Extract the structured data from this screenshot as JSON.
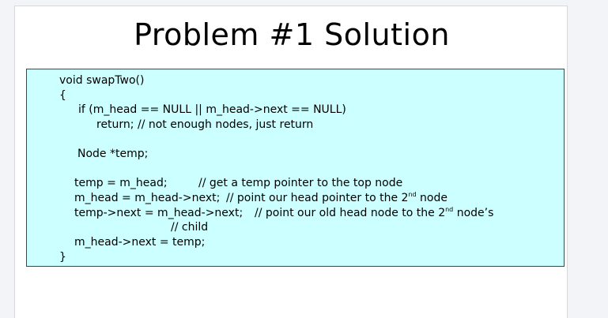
{
  "slide": {
    "title": "Problem #1 Solution"
  },
  "code": {
    "l1": "void swapTwo()",
    "l2": "{",
    "l3": "if (m_head == NULL || m_head->next == NULL)",
    "l4": "return; // not enough nodes, just return",
    "l5": "Node *temp;",
    "l6a": "temp = m_head;",
    "l6b": "// get a temp pointer to the top node",
    "l7a": "m_head = m_head->next;",
    "l7b": "// point our head pointer to the 2",
    "l7sup": "nd",
    "l7c": " node",
    "l8a": "temp->next = m_head->next;",
    "l8b": "// point our old head node to the 2",
    "l8sup": "nd",
    "l8c": " node’s",
    "l9": "// child",
    "l10": "m_head->next = temp;",
    "l11": "}"
  },
  "colors": {
    "code_background": "#ccffff",
    "page_background": "#f3f4f7"
  }
}
